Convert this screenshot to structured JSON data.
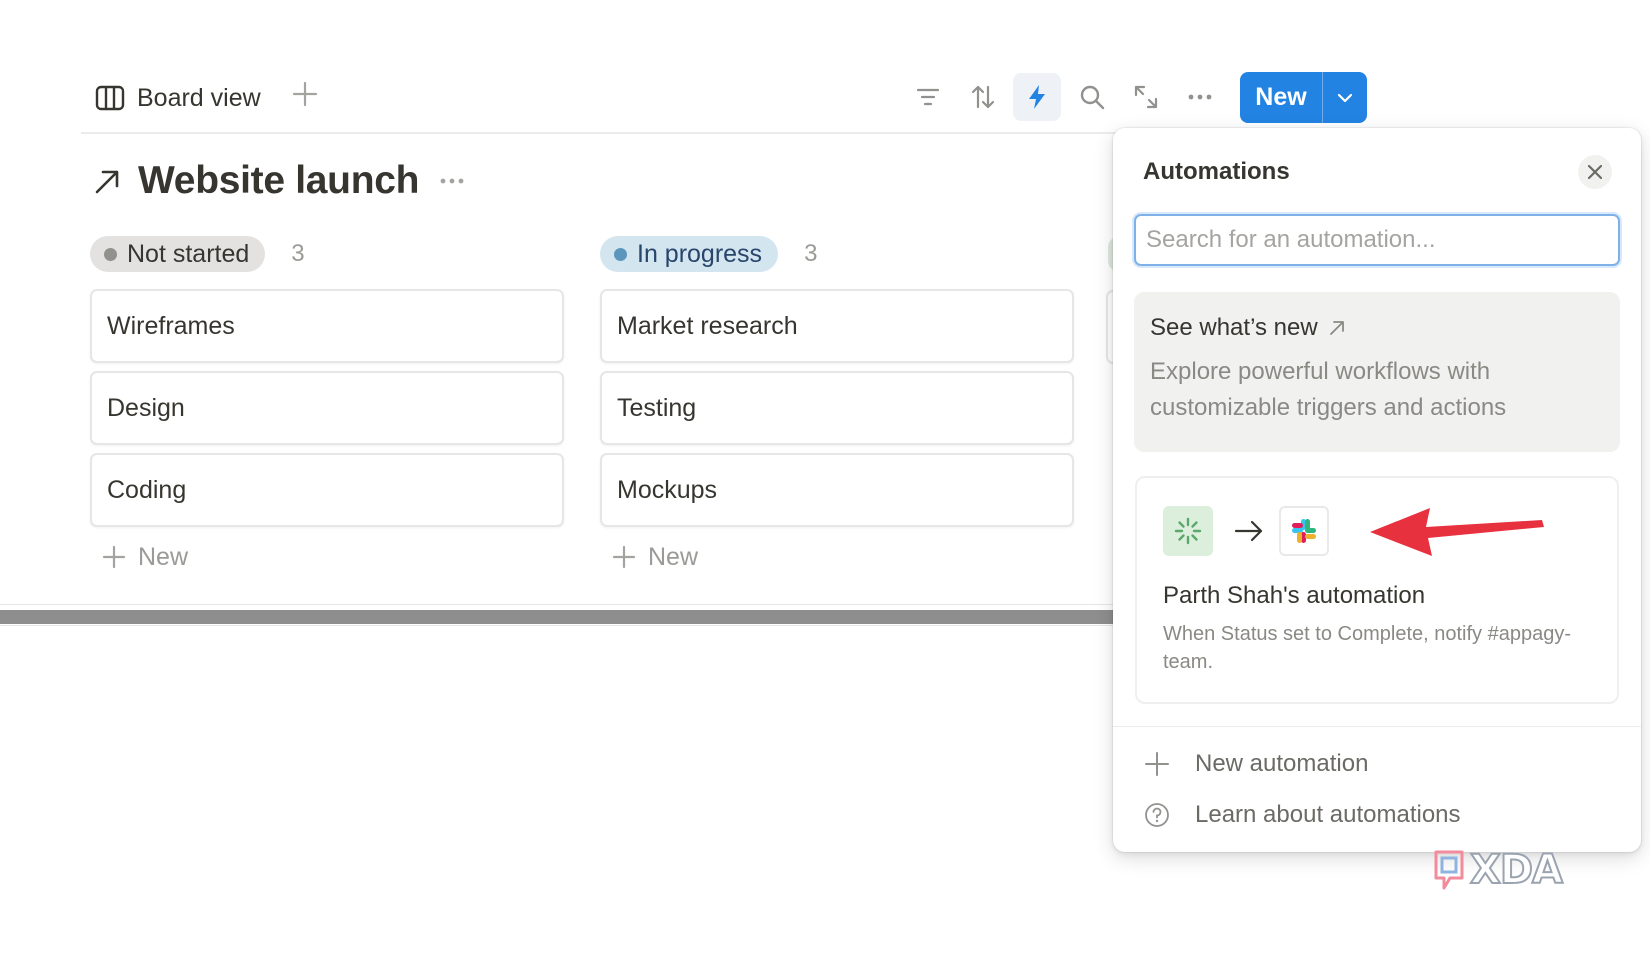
{
  "toolbar": {
    "view_label": "Board view",
    "new_label": "New",
    "icons": [
      "board-view-icon",
      "add-view-icon",
      "filter-icon",
      "sort-icon",
      "automation-bolt-icon",
      "search-icon",
      "expand-icon",
      "more-icon",
      "chevron-down-icon"
    ]
  },
  "page": {
    "title": "Website launch"
  },
  "board": {
    "columns": [
      {
        "status": "Not started",
        "count": "3",
        "pill_color": "#e3e2e0",
        "dot_color": "#91918e",
        "cards": [
          "Wireframes",
          "Design",
          "Coding"
        ],
        "add_label": "New"
      },
      {
        "status": "In progress",
        "count": "3",
        "pill_color": "#d3e5ef",
        "dot_color": "#5b97bd",
        "cards": [
          "Market research",
          "Testing",
          "Mockups"
        ],
        "add_label": "New"
      }
    ]
  },
  "automations": {
    "title": "Automations",
    "search_placeholder": "Search for an automation...",
    "whats_new": {
      "title": "See what’s new",
      "description": "Explore powerful workflows with customizable triggers and actions"
    },
    "items": [
      {
        "name": "Parth Shah's automation",
        "description": "When Status set to Complete, notify #appagy-team.",
        "trigger_icon": "status-trigger-icon",
        "action_icon": "slack-icon"
      }
    ],
    "footer": {
      "new_automation": "New automation",
      "learn_more": "Learn about automations"
    }
  },
  "colors": {
    "accent": "#2383e2",
    "annotation_arrow": "#e8313f"
  },
  "watermark": "XDA"
}
